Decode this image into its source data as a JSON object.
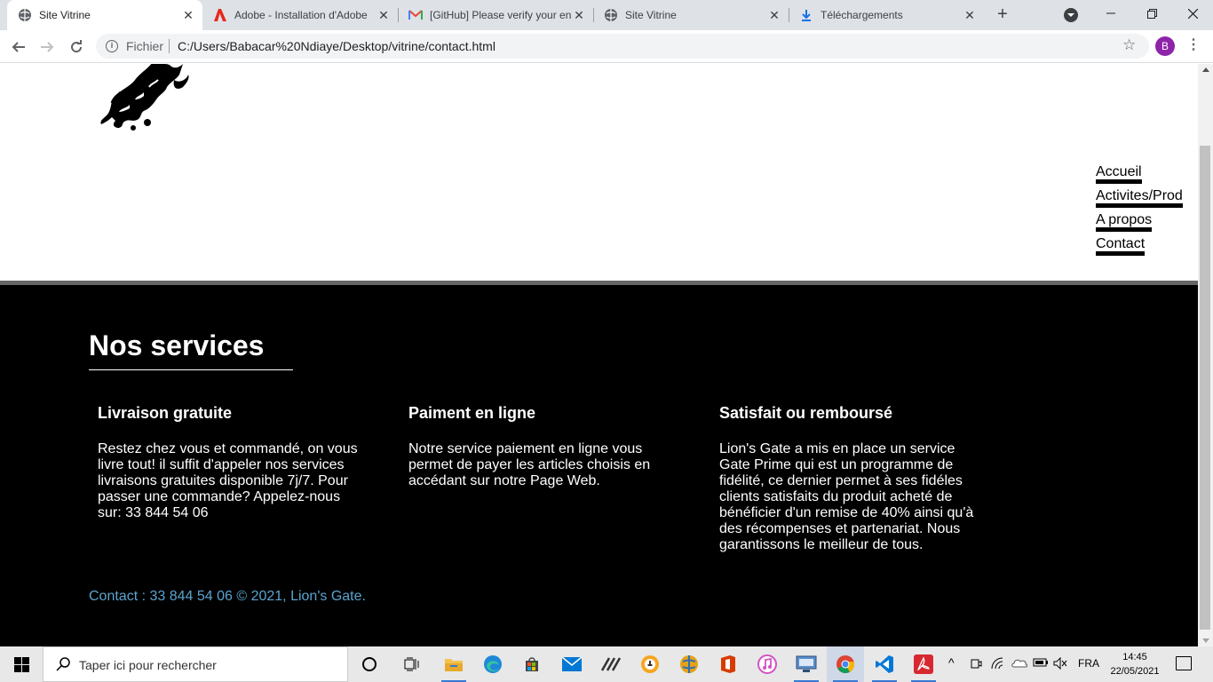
{
  "browser": {
    "tabs": [
      {
        "title": "Site Vitrine",
        "active": true,
        "icon": "globe-icon"
      },
      {
        "title": "Adobe - Installation d'Adobe",
        "active": false,
        "icon": "adobe-icon"
      },
      {
        "title": "[GitHub] Please verify your en",
        "active": false,
        "icon": "gmail-icon"
      },
      {
        "title": "Site Vitrine",
        "active": false,
        "icon": "globe-icon"
      },
      {
        "title": "Téléchargements",
        "active": false,
        "icon": "download-icon"
      }
    ],
    "scheme_label": "Fichier",
    "url": "C:/Users/Babacar%20Ndiaye/Desktop/vitrine/contact.html",
    "profile_initial": "B"
  },
  "site": {
    "nav": [
      "Accueil",
      "Activites/Prod",
      "A propos",
      "Contact"
    ],
    "services_title": "Nos services",
    "services": [
      {
        "title": "Livraison gratuite",
        "text": "Restez chez vous et commandé, on vous livre tout! il suffit d'appeler nos services livraisons gratuites disponible 7j/7. Pour passer une commande? Appelez-nous sur: 33 844 54 06"
      },
      {
        "title": "Paiment en ligne",
        "text": "Notre service paiement en ligne vous permet de payer les articles choisis en accédant sur notre Page Web."
      },
      {
        "title": "Satisfait ou remboursé",
        "text": "Lion's Gate a mis en place un service Gate Prime qui est un programme de fidélité, ce dernier permet à ses fidéles clients satisfaits du produit acheté de bénéficier d'un remise de 40% ainsi qu'à des récompenses et partenariat. Nous garantissons le meilleur de tous."
      }
    ],
    "footer_contact": "Contact : 33 844 54 06 © 2021, Lion's Gate."
  },
  "taskbar": {
    "search_placeholder": "Taper ici pour rechercher",
    "language": "FRA",
    "time": "14:45",
    "date": "22/05/2021"
  },
  "colors": {
    "footer_bg": "#000000",
    "footer_link": "#5ba4cf",
    "tabstrip_bg": "#dee1e6",
    "avatar": "#8e24aa"
  }
}
